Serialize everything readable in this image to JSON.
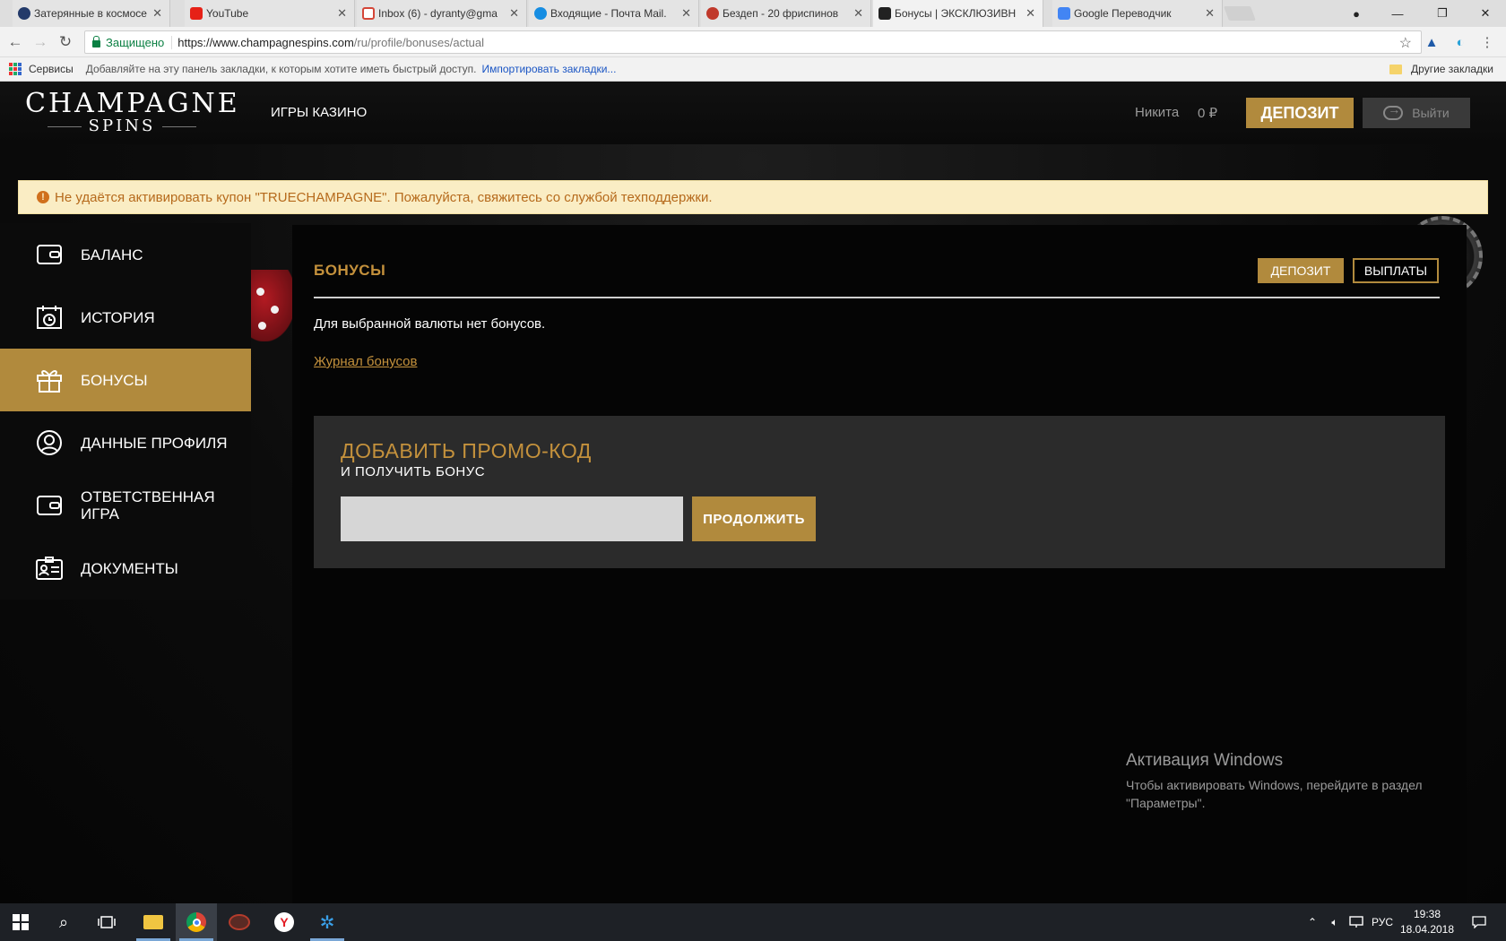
{
  "browser": {
    "tabs": [
      {
        "title": "Затерянные в космосе",
        "favicon_color": "#233a6a",
        "active": false
      },
      {
        "title": "YouTube",
        "favicon_color": "#e62117",
        "active": false
      },
      {
        "title": "Inbox (6) - dyranty@gma",
        "favicon_color": "#d44638",
        "active": false
      },
      {
        "title": "Входящие - Почта Mail.",
        "favicon_color": "#168de2",
        "active": false
      },
      {
        "title": "Бездеп - 20 фриспинов",
        "favicon_color": "#c0392b",
        "active": false
      },
      {
        "title": "Бонусы | ЭКСКЛЮЗИВН",
        "favicon_color": "#222222",
        "active": true
      },
      {
        "title": "Google Переводчик",
        "favicon_color": "#4285f4",
        "active": false
      }
    ],
    "tab_close": "✕",
    "window_controls": {
      "minimize": "—",
      "restore": "❐",
      "close": "✕"
    },
    "address": {
      "secure_label": "Защищено",
      "url_host": "https://www.champagnespins.com",
      "url_path": "/ru/profile/bonuses/actual"
    },
    "nav_icons": {
      "back": "←",
      "forward": "→",
      "reload": "↻",
      "star": "☆"
    },
    "bookmarks": {
      "services": "Сервисы",
      "hint": "Добавляйте на эту панель закладки, к которым хотите иметь быстрый доступ.",
      "import": "Импортировать закладки...",
      "other": "Другие закладки"
    }
  },
  "site": {
    "logo_top": "CHAMPAGNE",
    "logo_bottom": "SPINS",
    "nav_games": "ИГРЫ КАЗИНО",
    "user_name": "Никита",
    "user_balance": "0 ₽",
    "deposit_button": "ДЕПОЗИТ",
    "logout_button": "Выйти",
    "alert_text": "Не удаётся активировать купон \"TRUECHAMPAGNE\". Пожалуйста, свяжитесь со службой техподдержки.",
    "sidebar": [
      {
        "label": "БАЛАНС",
        "icon": "wallet-icon",
        "active": false
      },
      {
        "label": "ИСТОРИЯ",
        "icon": "calendar-clock-icon",
        "active": false
      },
      {
        "label": "БОНУСЫ",
        "icon": "gift-icon",
        "active": true
      },
      {
        "label": "ДАННЫЕ ПРОФИЛЯ",
        "icon": "user-circle-icon",
        "active": false
      },
      {
        "label": "ОТВЕТСТВЕННАЯ ИГРА",
        "icon": "wallet-icon",
        "active": false
      },
      {
        "label": "ДОКУМЕНТЫ",
        "icon": "id-card-icon",
        "active": false
      }
    ],
    "main": {
      "title": "БОНУСЫ",
      "deposit_button": "ДЕПОЗИТ",
      "payouts_button": "ВЫПЛАТЫ",
      "no_bonus_text": "Для выбранной валюты нет бонусов.",
      "journal_link": "Журнал бонусов",
      "promo": {
        "title": "ДОБАВИТЬ ПРОМО-КОД",
        "subtitle": "И ПОЛУЧИТЬ БОНУС",
        "input_value": "",
        "button": "ПРОДОЛЖИТЬ"
      }
    }
  },
  "windows_activation": {
    "title": "Активация Windows",
    "line1": "Чтобы активировать Windows, перейдите в раздел",
    "line2": "\"Параметры\"."
  },
  "taskbar": {
    "language": "РУС",
    "time": "19:38",
    "date": "18.04.2018"
  },
  "colors": {
    "accent_gold": "#b18a3d",
    "title_gold": "#c4913c",
    "alert_bg": "#faedc4",
    "alert_text": "#b66a1c"
  }
}
